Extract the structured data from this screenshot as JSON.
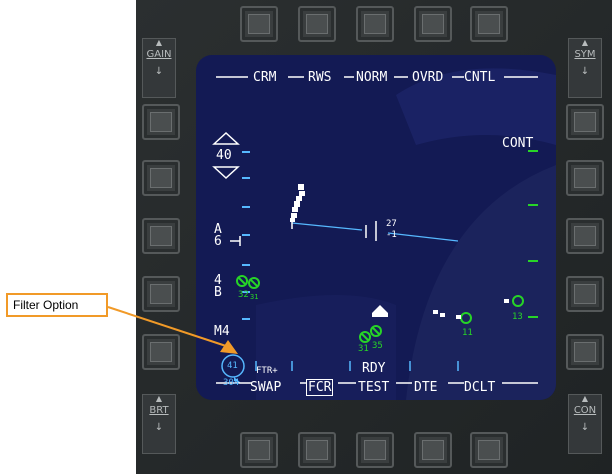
{
  "annotation": {
    "label": "Filter Option",
    "color": "#f19a28"
  },
  "colors": {
    "screen_bg": "#131a54",
    "symbol_white": "#ffffff",
    "symbol_green": "#27d427",
    "symbol_cyan": "#56b8ff"
  },
  "rockers": {
    "gain": {
      "label": "GAIN",
      "up": "▲",
      "down": "↓"
    },
    "sym": {
      "label": "SYM",
      "up": "▲",
      "down": "↓"
    },
    "brt": {
      "label": "BRT",
      "up": "▲",
      "down": "↓"
    },
    "con": {
      "label": "CON",
      "up": "▲",
      "down": "↓"
    }
  },
  "top_labels": [
    "CRM",
    "RWS",
    "NORM",
    "OVRD",
    "CNTL"
  ],
  "bottom_labels": [
    "SWAP",
    "FCR",
    "TEST",
    "DTE",
    "DCLT"
  ],
  "right_labels": {
    "cont": "CONT"
  },
  "range": {
    "value": "40",
    "up_icon": "range-up-caret",
    "down_icon": "range-down-caret"
  },
  "azimuth": {
    "top": "A",
    "bottom": "6"
  },
  "bars": {
    "top": "4",
    "bottom": "B"
  },
  "mode": {
    "master": "M4",
    "filter": "FTR+",
    "status": "RDY"
  },
  "elevation": {
    "top": "27",
    "bottom": "-1"
  },
  "bullseye": {
    "bearing": "41",
    "range": "304"
  },
  "targets": [
    {
      "label": "32",
      "sub": "31"
    },
    {
      "label": "31",
      "sub": "35"
    },
    {
      "label": "11",
      "sub": ""
    },
    {
      "label": "13",
      "sub": ""
    }
  ],
  "side_osbs": {
    "left_count": 5,
    "right_count": 5
  }
}
